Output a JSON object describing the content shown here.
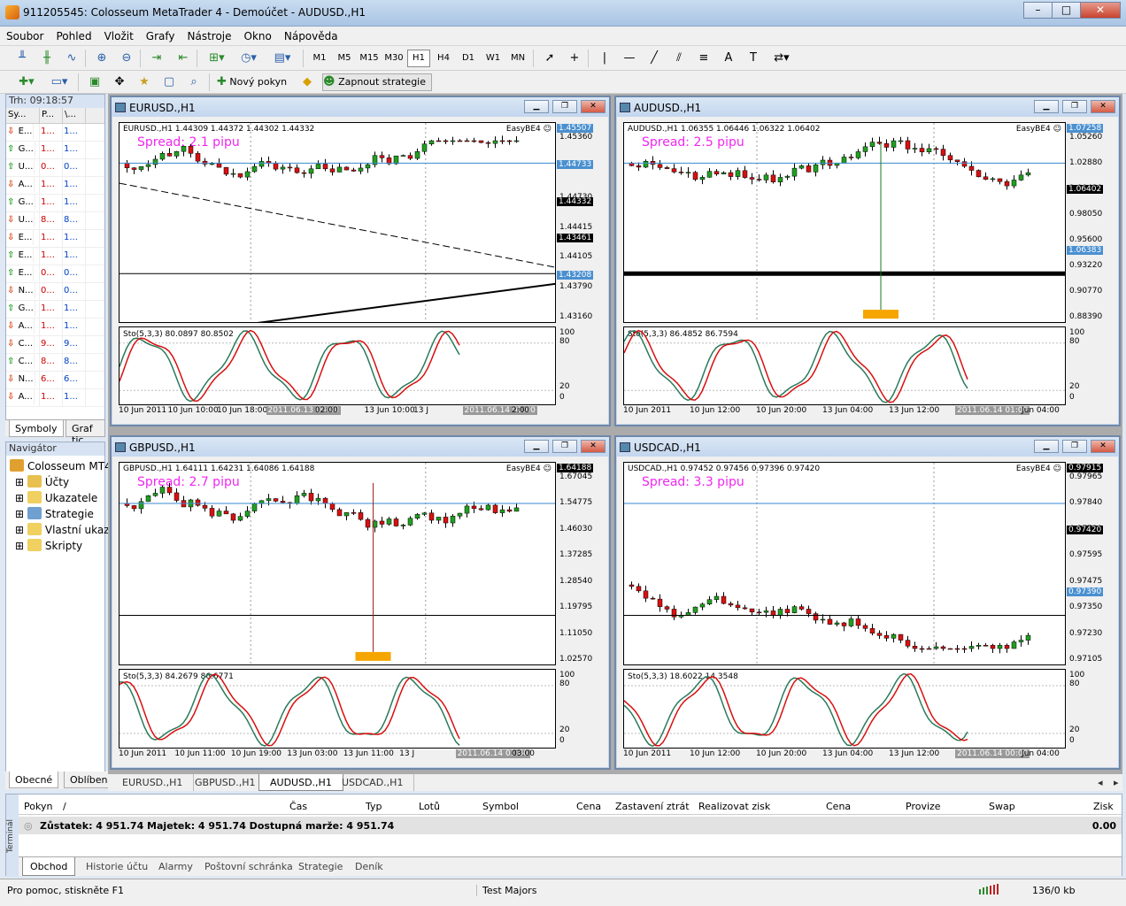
{
  "window": {
    "title": "911205545: Colosseum MetaTrader 4 - Demoúčet - AUDUSD.,H1"
  },
  "menu": [
    "Soubor",
    "Pohled",
    "Vložit",
    "Grafy",
    "Nástroje",
    "Okno",
    "Nápověda"
  ],
  "toolbar": {
    "timeframes": [
      "M1",
      "M5",
      "M15",
      "M30",
      "H1",
      "H4",
      "D1",
      "W1",
      "MN"
    ],
    "selected_timeframe": "H1",
    "new_order": "Nový pokyn",
    "autotrading": "Zapnout strategie",
    "text_tool": "A"
  },
  "market_watch": {
    "header": "Trh: 09:18:57",
    "cols": [
      "Sy...",
      "P...",
      "\\..."
    ],
    "rows": [
      {
        "dir": "down",
        "s": "E...",
        "b": "1...",
        "a": "1..."
      },
      {
        "dir": "up",
        "s": "G...",
        "b": "1...",
        "a": "1..."
      },
      {
        "dir": "up",
        "s": "U...",
        "b": "0...",
        "a": "0..."
      },
      {
        "dir": "down",
        "s": "A...",
        "b": "1...",
        "a": "1..."
      },
      {
        "dir": "up",
        "s": "G...",
        "b": "1...",
        "a": "1..."
      },
      {
        "dir": "down",
        "s": "U...",
        "b": "8...",
        "a": "8..."
      },
      {
        "dir": "down",
        "s": "E...",
        "b": "1...",
        "a": "1..."
      },
      {
        "dir": "up",
        "s": "E...",
        "b": "1...",
        "a": "1..."
      },
      {
        "dir": "up",
        "s": "E...",
        "b": "0...",
        "a": "0..."
      },
      {
        "dir": "down",
        "s": "N...",
        "b": "0...",
        "a": "0..."
      },
      {
        "dir": "up",
        "s": "G...",
        "b": "1...",
        "a": "1..."
      },
      {
        "dir": "down",
        "s": "A...",
        "b": "1...",
        "a": "1..."
      },
      {
        "dir": "down",
        "s": "C...",
        "b": "9...",
        "a": "9..."
      },
      {
        "dir": "up",
        "s": "C...",
        "b": "8...",
        "a": "8..."
      },
      {
        "dir": "down",
        "s": "N...",
        "b": "6...",
        "a": "6..."
      },
      {
        "dir": "down",
        "s": "A...",
        "b": "1...",
        "a": "1..."
      }
    ],
    "tabs": [
      "Symboly",
      "Graf tic"
    ]
  },
  "navigator": {
    "header": "Navigátor",
    "root": "Colosseum MT4",
    "items": [
      "Účty",
      "Ukazatele",
      "Strategie",
      "Vlastní ukaz",
      "Skripty"
    ],
    "tabs": [
      "Obecné",
      "Oblíbené"
    ]
  },
  "charts": [
    {
      "name": "EURUSD.,H1",
      "symbol_line": "EURUSD.,H1  1.44309 1.44372 1.44302 1.44332",
      "spread": "Spread: 2.1 pipu",
      "ea": "EasyBE4",
      "y_ticks": [
        "1.45360",
        "1.45050",
        "1.44730",
        "1.44415",
        "1.44105",
        "1.43790",
        "1.43160"
      ],
      "y_boxes": [
        {
          "v": "1.45507",
          "c": "#4a90d0"
        },
        {
          "v": "1.44733",
          "c": "#4a90d0"
        },
        {
          "v": "1.44332",
          "c": "#000"
        },
        {
          "v": "1.43461",
          "c": "#000"
        },
        {
          "v": "1.43208",
          "c": "#4a90d0"
        }
      ],
      "sto": "Sto(5,3,3) 80.0897 80.8502",
      "x_labels": [
        "10 Jun 2011",
        "10 Jun 10:00",
        "10 Jun 18:00",
        "2011.06.13 00:00",
        "02:00",
        "13 Jun 10:00",
        "13 J",
        "2011.06.14 01:00",
        "2:00"
      ]
    },
    {
      "name": "AUDUSD.,H1",
      "symbol_line": "AUDUSD.,H1  1.06355 1.06446 1.06322 1.06402",
      "spread": "Spread: 2.5 pipu",
      "ea": "EasyBE4",
      "y_ticks": [
        "1.05260",
        "1.02880",
        "1.00430",
        "0.98050",
        "0.95600",
        "0.93220",
        "0.90770",
        "0.88390"
      ],
      "y_boxes": [
        {
          "v": "1.07258",
          "c": "#4a90d0"
        },
        {
          "v": "1.06402",
          "c": "#000"
        },
        {
          "v": "1.06383",
          "c": "#4a90d0"
        }
      ],
      "sto": "Sto(5,3,3) 86.4852 86.7594",
      "x_labels": [
        "10 Jun 2011",
        "10 Jun 12:00",
        "10 Jun 20:00",
        "13 Jun 04:00",
        "13 Jun 12:00",
        "2011.06.14 01:00",
        "Jun 04:00"
      ]
    },
    {
      "name": "GBPUSD.,H1",
      "symbol_line": "GBPUSD.,H1  1.64111 1.64231 1.64086 1.64188",
      "spread": "Spread: 2.7 pipu",
      "ea": "EasyBE4",
      "y_ticks": [
        "1.67045",
        "1.54775",
        "1.46030",
        "1.37285",
        "1.28540",
        "1.19795",
        "1.11050",
        "1.02570"
      ],
      "y_boxes": [
        {
          "v": "1.64188",
          "c": "#000"
        }
      ],
      "sto": "Sto(5,3,3) 84.2679 86.6771",
      "x_labels": [
        "10 Jun 2011",
        "10 Jun 11:00",
        "10 Jun 19:00",
        "13 Jun 03:00",
        "13 Jun 11:00",
        "13 J",
        "2011.06.14 01:00",
        "03:00"
      ]
    },
    {
      "name": "USDCAD.,H1",
      "symbol_line": "USDCAD.,H1  0.97452 0.97456 0.97396 0.97420",
      "spread": "Spread: 3.3 pipu",
      "ea": "EasyBE4",
      "y_ticks": [
        "0.97965",
        "0.97840",
        "0.97720",
        "0.97595",
        "0.97475",
        "0.97350",
        "0.97230",
        "0.97105"
      ],
      "y_boxes": [
        {
          "v": "0.97915",
          "c": "#000"
        },
        {
          "v": "0.97420",
          "c": "#000"
        },
        {
          "v": "0.97390",
          "c": "#4a90d0"
        }
      ],
      "sto": "Sto(5,3,3) 18.6022 14.3548",
      "x_labels": [
        "10 Jun 2011",
        "10 Jun 12:00",
        "10 Jun 20:00",
        "13 Jun 04:00",
        "13 Jun 12:00",
        "2011.06.14 00:00",
        "Jun 04:00"
      ]
    }
  ],
  "sto_levels": {
    "top": "100",
    "l80": "80",
    "l20": "20",
    "bottom": "0"
  },
  "chart_tabs": [
    "EURUSD.,H1",
    "GBPUSD.,H1",
    "AUDUSD.,H1",
    "USDCAD.,H1"
  ],
  "active_chart_tab": "AUDUSD.,H1",
  "terminal": {
    "side_label": "Terminál",
    "columns": [
      "Pokyn",
      "/",
      "Čas",
      "Typ",
      "Lotů",
      "Symbol",
      "Cena",
      "Zastavení ztrát",
      "Realizovat zisk",
      "Cena",
      "Provize",
      "Swap",
      "Zisk"
    ],
    "balance": "Zůstatek: 4 951.74  Majetek: 4 951.74  Dostupná marže: 4 951.74",
    "profit": "0.00",
    "tabs": [
      "Obchod",
      "Historie účtu",
      "Alarmy",
      "Poštovní schránka",
      "Strategie",
      "Deník"
    ]
  },
  "status": {
    "help": "Pro pomoc, stiskněte F1",
    "profile": "Test Majors",
    "traffic": "136/0 kb"
  }
}
